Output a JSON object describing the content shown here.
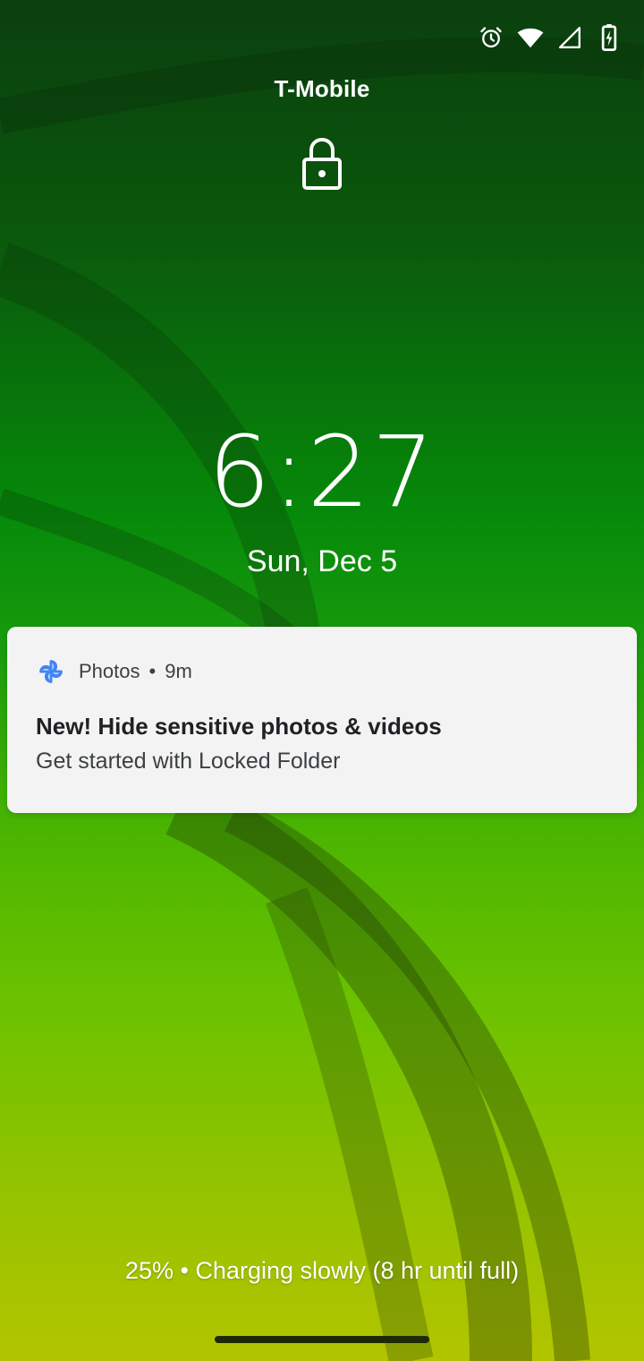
{
  "status_bar": {
    "icons": [
      "alarm-icon",
      "wifi-icon",
      "cell-signal-icon",
      "battery-charging-icon"
    ]
  },
  "carrier": "T-Mobile",
  "lock_icon": "padlock-icon",
  "clock": {
    "time": "6:27"
  },
  "date": "Sun, Dec 5",
  "notification": {
    "app_icon": "pinwheel-icon",
    "app_name": "Photos",
    "separator": "•",
    "time": "9m",
    "title": "New! Hide sensitive photos & videos",
    "body": "Get started with Locked Folder",
    "colors": {
      "icon_blue": "#4285f4",
      "background": "#f3f3f3"
    }
  },
  "charging_status": "25% • Charging slowly (8 hr until full)",
  "colors": {
    "wallpaper_top": "#0b3f0e",
    "wallpaper_mid": "#1a9c0c",
    "wallpaper_bottom": "#b3c400"
  }
}
